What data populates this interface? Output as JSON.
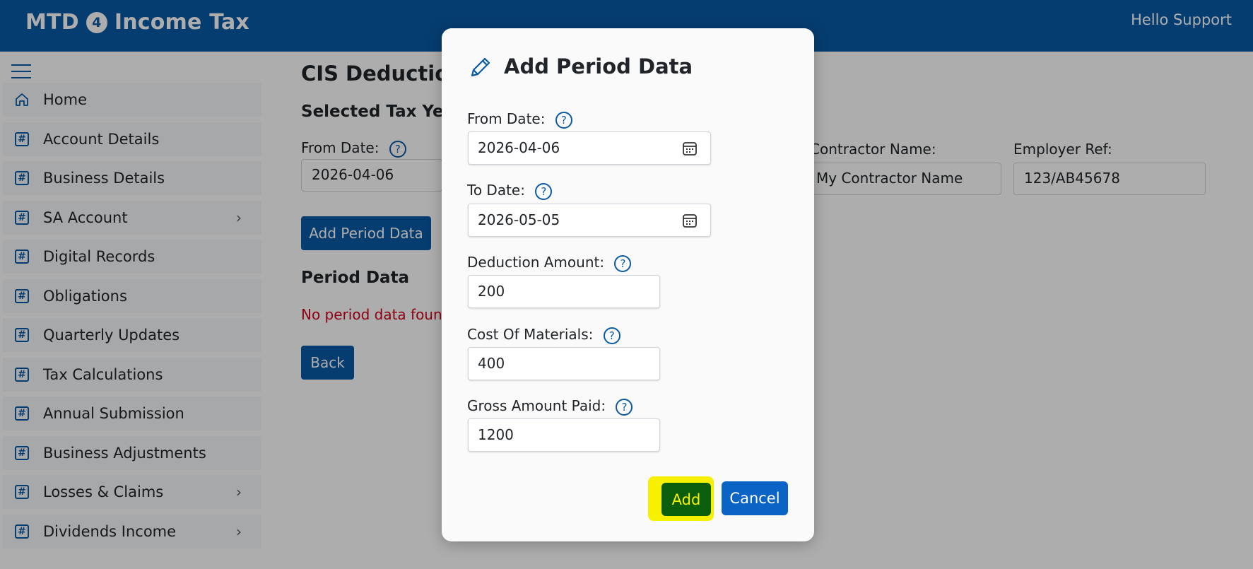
{
  "header": {
    "brand_prefix": "MTD",
    "brand_badge": "4",
    "brand_suffix": "Income Tax",
    "greeting": "Hello Support"
  },
  "sidebar": {
    "items": [
      {
        "label": "Home",
        "icon": "home-icon",
        "has_submenu": false
      },
      {
        "label": "Account Details",
        "icon": "hash-icon",
        "has_submenu": false
      },
      {
        "label": "Business Details",
        "icon": "hash-icon",
        "has_submenu": false
      },
      {
        "label": "SA Account",
        "icon": "hash-icon",
        "has_submenu": true
      },
      {
        "label": "Digital Records",
        "icon": "hash-icon",
        "has_submenu": false
      },
      {
        "label": "Obligations",
        "icon": "hash-icon",
        "has_submenu": false
      },
      {
        "label": "Quarterly Updates",
        "icon": "hash-icon",
        "has_submenu": false
      },
      {
        "label": "Tax Calculations",
        "icon": "hash-icon",
        "has_submenu": false
      },
      {
        "label": "Annual Submission",
        "icon": "hash-icon",
        "has_submenu": false
      },
      {
        "label": "Business Adjustments",
        "icon": "hash-icon",
        "has_submenu": false
      },
      {
        "label": "Losses & Claims",
        "icon": "hash-icon",
        "has_submenu": true
      },
      {
        "label": "Dividends Income",
        "icon": "hash-icon",
        "has_submenu": true
      }
    ]
  },
  "main": {
    "title": "CIS Deductions",
    "selected_tax_year_label": "Selected Tax Year:",
    "from_date_label": "From Date:",
    "from_date_value": "2026-04-06",
    "contractor_name_label": "Contractor Name:",
    "contractor_name_value": "My Contractor Name",
    "employer_ref_label": "Employer Ref:",
    "employer_ref_value": "123/AB45678",
    "add_period_button": "Add Period Data",
    "period_data_heading": "Period Data",
    "no_data_message": "No period data found",
    "back_button": "Back"
  },
  "modal": {
    "title": "Add Period Data",
    "from_date_label": "From Date:",
    "from_date_value": "2026-04-06",
    "to_date_label": "To Date:",
    "to_date_value": "2026-05-05",
    "deduction_amount_label": "Deduction Amount:",
    "deduction_amount_value": "200",
    "cost_of_materials_label": "Cost Of Materials:",
    "cost_of_materials_value": "400",
    "gross_amount_paid_label": "Gross Amount Paid:",
    "gross_amount_paid_value": "1200",
    "add_button": "Add",
    "cancel_button": "Cancel",
    "help_glyph": "?"
  },
  "colors": {
    "brand_blue": "#0a5aa6",
    "add_button_bg": "#0b5e0b",
    "highlight": "#f7f000",
    "error_text": "#d0021b"
  }
}
